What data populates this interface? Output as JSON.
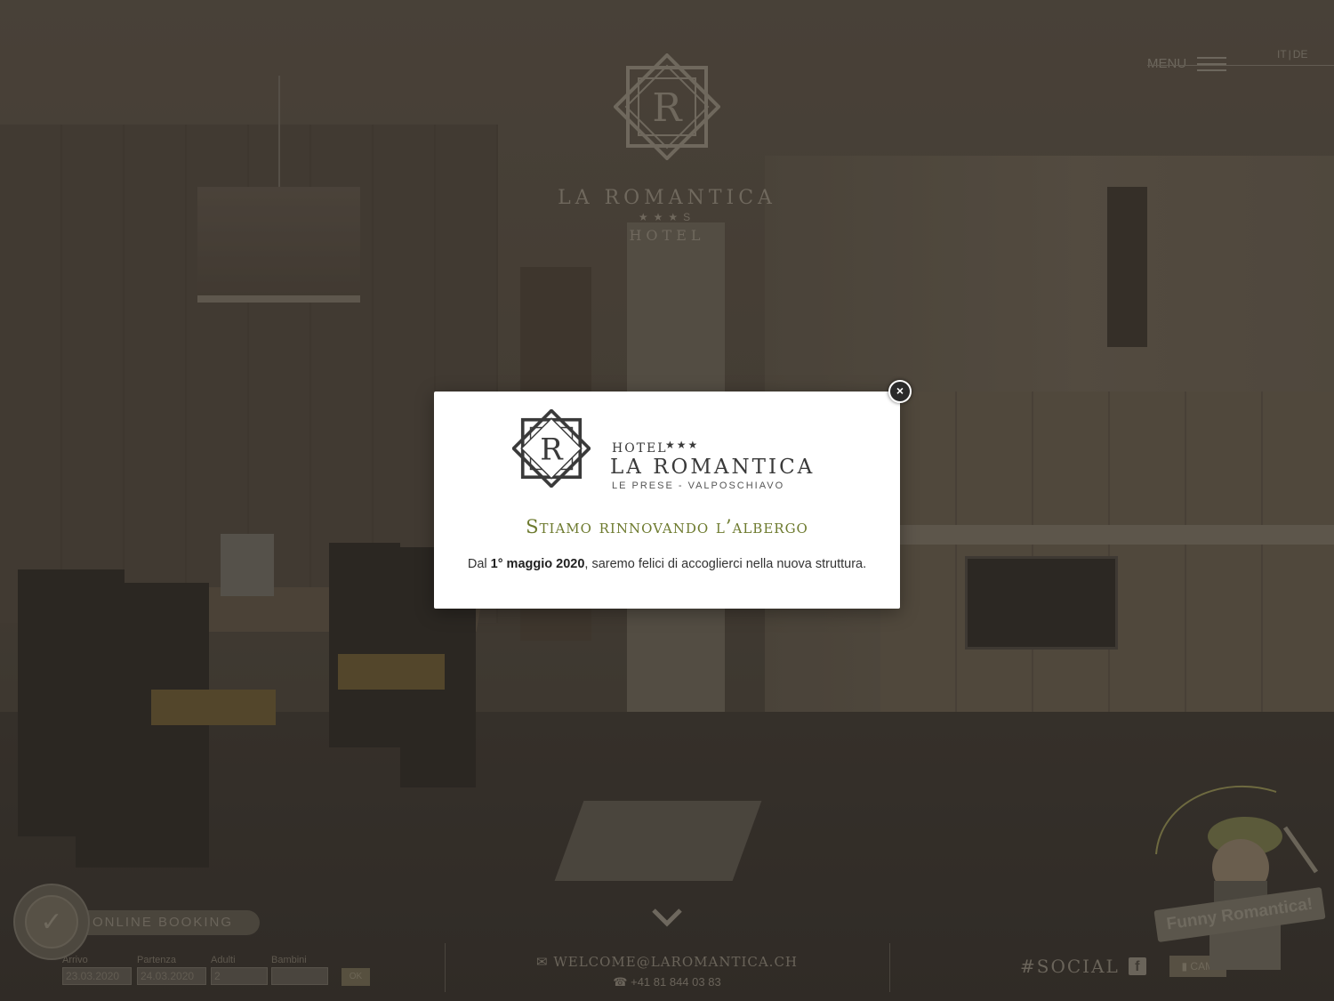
{
  "header": {
    "logo": {
      "name": "LA ROMANTICA",
      "stars": "★★★S",
      "hotel": "HOTEL"
    },
    "menu_label": "MENU",
    "languages": [
      "IT",
      "DE"
    ]
  },
  "modal": {
    "logo": {
      "hotel": "HOTEL",
      "stars": "★★★",
      "name": "LA ROMANTICA",
      "place": "LE PRESE - VALPOSCHIAVO"
    },
    "title": "Stiamo rinnovando l’albergo",
    "text_prefix": "Dal ",
    "text_bold": "1° maggio 2020",
    "text_suffix": ", saremo felici di accoglierci nella nuova struttura.",
    "close_label": "×"
  },
  "booking": {
    "button_label": "ONLINE BOOKING",
    "arrival_label": "Arrivo",
    "arrival_value": "23.03.2020",
    "departure_label": "Partenza",
    "departure_value": "24.03.2020",
    "adults_label": "Adulti",
    "adults_value": "2",
    "children_label": "Bambini",
    "children_value": "",
    "submit_label": "OK"
  },
  "contact": {
    "email": "WELCOME@LAROMANTICA.CH",
    "phone": "+41 81 844 03 83"
  },
  "social": {
    "tag": "#SOCIAL",
    "facebook_glyph": "f",
    "cam_label": "CAM"
  },
  "mascot": {
    "badge": "Funny Romantica!"
  }
}
